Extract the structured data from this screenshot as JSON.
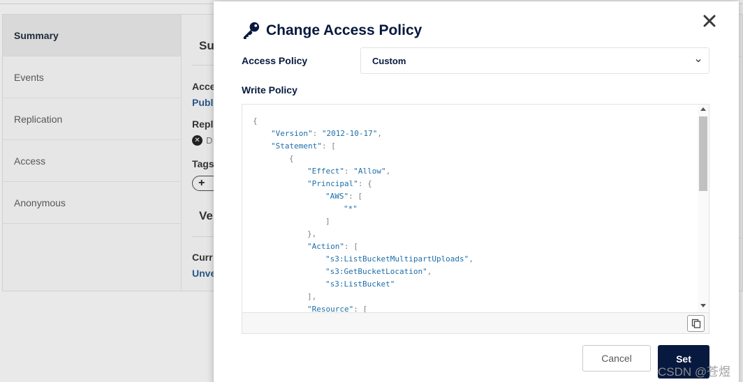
{
  "background": {
    "tabs": [
      {
        "label": "Summary",
        "active": true
      },
      {
        "label": "Events",
        "active": false
      },
      {
        "label": "Replication",
        "active": false
      },
      {
        "label": "Access",
        "active": false
      },
      {
        "label": "Anonymous",
        "active": false
      }
    ],
    "content": {
      "summary_heading": "Su",
      "access_label": "Acce",
      "access_value": "Publ",
      "replication_label": "Repl",
      "replication_status": "D",
      "tags_label": "Tags",
      "tags_add": "+",
      "versioning_heading": "Ve",
      "current_label": "Curr",
      "current_value": "Unve"
    }
  },
  "modal": {
    "title": "Change Access Policy",
    "title_icon": "key-icon",
    "close_icon": "close-icon",
    "access_policy_label": "Access Policy",
    "access_policy_value": "Custom",
    "write_policy_label": "Write Policy",
    "policy_lines": [
      {
        "indent": 0,
        "tokens": [
          {
            "t": "punc",
            "v": "{"
          }
        ]
      },
      {
        "indent": 1,
        "tokens": [
          {
            "t": "key",
            "v": "\"Version\""
          },
          {
            "t": "punc",
            "v": ": "
          },
          {
            "t": "str",
            "v": "\"2012-10-17\""
          },
          {
            "t": "punc",
            "v": ","
          }
        ]
      },
      {
        "indent": 1,
        "tokens": [
          {
            "t": "key",
            "v": "\"Statement\""
          },
          {
            "t": "punc",
            "v": ": ["
          }
        ]
      },
      {
        "indent": 2,
        "tokens": [
          {
            "t": "punc",
            "v": "{"
          }
        ]
      },
      {
        "indent": 3,
        "tokens": [
          {
            "t": "key",
            "v": "\"Effect\""
          },
          {
            "t": "punc",
            "v": ": "
          },
          {
            "t": "str",
            "v": "\"Allow\""
          },
          {
            "t": "punc",
            "v": ","
          }
        ]
      },
      {
        "indent": 3,
        "tokens": [
          {
            "t": "key",
            "v": "\"Principal\""
          },
          {
            "t": "punc",
            "v": ": {"
          }
        ]
      },
      {
        "indent": 4,
        "tokens": [
          {
            "t": "key",
            "v": "\"AWS\""
          },
          {
            "t": "punc",
            "v": ": ["
          }
        ]
      },
      {
        "indent": 5,
        "tokens": [
          {
            "t": "str",
            "v": "\"*\""
          }
        ]
      },
      {
        "indent": 4,
        "tokens": [
          {
            "t": "punc",
            "v": "]"
          }
        ]
      },
      {
        "indent": 3,
        "tokens": [
          {
            "t": "punc",
            "v": "},"
          }
        ]
      },
      {
        "indent": 3,
        "tokens": [
          {
            "t": "key",
            "v": "\"Action\""
          },
          {
            "t": "punc",
            "v": ": ["
          }
        ]
      },
      {
        "indent": 4,
        "tokens": [
          {
            "t": "str",
            "v": "\"s3:ListBucketMultipartUploads\""
          },
          {
            "t": "punc",
            "v": ","
          }
        ]
      },
      {
        "indent": 4,
        "tokens": [
          {
            "t": "str",
            "v": "\"s3:GetBucketLocation\""
          },
          {
            "t": "punc",
            "v": ","
          }
        ]
      },
      {
        "indent": 4,
        "tokens": [
          {
            "t": "str",
            "v": "\"s3:ListBucket\""
          }
        ]
      },
      {
        "indent": 3,
        "tokens": [
          {
            "t": "punc",
            "v": "],"
          }
        ]
      },
      {
        "indent": 3,
        "tokens": [
          {
            "t": "key",
            "v": "\"Resource\""
          },
          {
            "t": "punc",
            "v": ": ["
          }
        ]
      }
    ],
    "copy_icon": "copy-icon",
    "cancel_label": "Cancel",
    "set_label": "Set"
  },
  "watermark": "CSDN @苍煜",
  "colors": {
    "navy": "#07193e",
    "json_blue": "#1d6ea8",
    "json_punc": "#808080"
  }
}
